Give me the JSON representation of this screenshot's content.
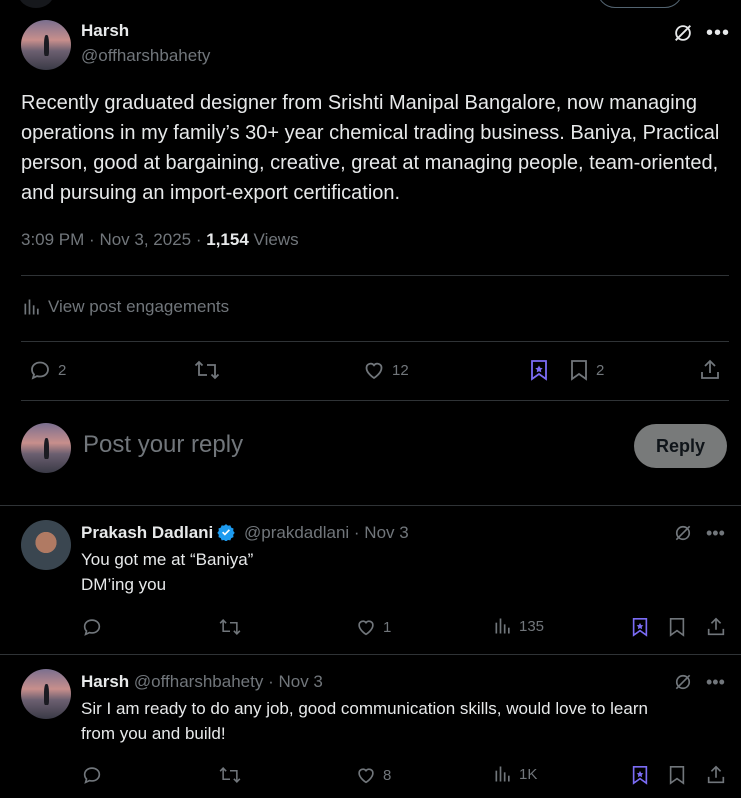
{
  "post": {
    "author_name": "Harsh",
    "author_handle": "@offharshbahety",
    "text": "Recently graduated designer from Srishti Manipal Bangalore, now managing operations in my family’s 30+ year chemical trading business. Baniya, Practical person, good at bargaining, creative, great at managing people, team-oriented, and pursuing an import-export certification.",
    "time": "3:09 PM",
    "date": "Nov 3, 2025",
    "views_count": "1,154",
    "views_label": "Views",
    "engagements_label": "View post engagements",
    "replies": "2",
    "likes": "12",
    "bookmarks": "2"
  },
  "reply_box": {
    "placeholder": "Post your reply",
    "button_label": "Reply"
  },
  "replies": [
    {
      "name": "Prakash Dadlani",
      "handle": "@prakdadlani",
      "date": "· Nov 3",
      "line1": "You got me at “Baniya”",
      "line2": "DM’ing you",
      "likes": "1",
      "views": "135"
    },
    {
      "name": "Harsh",
      "handle": "@offharshbahety",
      "date": "· Nov 3",
      "line1": "Sir I am ready to do any job, good communication skills, would love to learn",
      "line2": "from you and build!",
      "likes": "8",
      "views": "1K"
    }
  ],
  "colors": {
    "background": "#000000",
    "text": "#e7e9ea",
    "muted": "#71767b",
    "accent_purple": "#7b6cf5",
    "verified_blue": "#1d9bf0",
    "reply_button_bg": "#787a7a"
  }
}
